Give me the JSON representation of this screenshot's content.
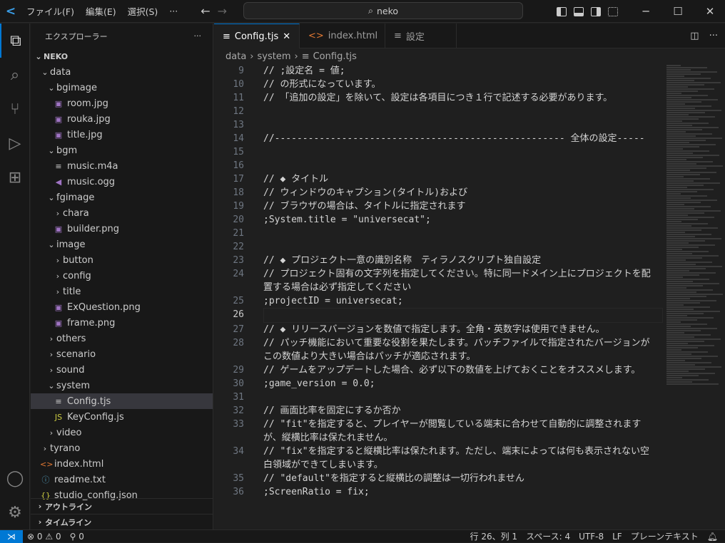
{
  "titlebar": {
    "menus": [
      "ファイル(F)",
      "編集(E)",
      "選択(S)",
      "···"
    ],
    "search": "neko"
  },
  "sidebar": {
    "title": "エクスプローラー",
    "more": "···",
    "root": "NEKO",
    "items": [
      {
        "label": "data",
        "depth": 1,
        "type": "folder-open"
      },
      {
        "label": "bgimage",
        "depth": 2,
        "type": "folder-open"
      },
      {
        "label": "room.jpg",
        "depth": 3,
        "type": "image"
      },
      {
        "label": "rouka.jpg",
        "depth": 3,
        "type": "image"
      },
      {
        "label": "title.jpg",
        "depth": 3,
        "type": "image"
      },
      {
        "label": "bgm",
        "depth": 2,
        "type": "folder-open"
      },
      {
        "label": "music.m4a",
        "depth": 3,
        "type": "text"
      },
      {
        "label": "music.ogg",
        "depth": 3,
        "type": "audio"
      },
      {
        "label": "fgimage",
        "depth": 2,
        "type": "folder-open"
      },
      {
        "label": "chara",
        "depth": 3,
        "type": "folder"
      },
      {
        "label": "builder.png",
        "depth": 3,
        "type": "image"
      },
      {
        "label": "image",
        "depth": 2,
        "type": "folder-open"
      },
      {
        "label": "button",
        "depth": 3,
        "type": "folder"
      },
      {
        "label": "config",
        "depth": 3,
        "type": "folder"
      },
      {
        "label": "title",
        "depth": 3,
        "type": "folder"
      },
      {
        "label": "ExQuestion.png",
        "depth": 3,
        "type": "image"
      },
      {
        "label": "frame.png",
        "depth": 3,
        "type": "image"
      },
      {
        "label": "others",
        "depth": 2,
        "type": "folder"
      },
      {
        "label": "scenario",
        "depth": 2,
        "type": "folder"
      },
      {
        "label": "sound",
        "depth": 2,
        "type": "folder"
      },
      {
        "label": "system",
        "depth": 2,
        "type": "folder-open"
      },
      {
        "label": "Config.tjs",
        "depth": 3,
        "type": "text",
        "selected": true
      },
      {
        "label": "KeyConfig.js",
        "depth": 3,
        "type": "js"
      },
      {
        "label": "video",
        "depth": 2,
        "type": "folder"
      },
      {
        "label": "tyrano",
        "depth": 1,
        "type": "folder"
      },
      {
        "label": "index.html",
        "depth": 1,
        "type": "html"
      },
      {
        "label": "readme.txt",
        "depth": 1,
        "type": "info"
      },
      {
        "label": "studio_config.json",
        "depth": 1,
        "type": "json"
      }
    ],
    "outline": "アウトライン",
    "timeline": "タイムライン"
  },
  "tabs": [
    {
      "label": "Config.tjs",
      "icon": "text",
      "active": true
    },
    {
      "label": "index.html",
      "icon": "html"
    },
    {
      "label": "設定",
      "icon": "text"
    }
  ],
  "breadcrumb": [
    "data",
    "system",
    "Config.tjs"
  ],
  "editor": {
    "current_line": 26,
    "lines": [
      {
        "n": "9",
        "t": "// ;設定名 = 値;"
      },
      {
        "n": "10",
        "t": "// の形式になっています。"
      },
      {
        "n": "11",
        "t": "// 「追加の設定」を除いて、設定は各項目につき１行で記述する必要があります。"
      },
      {
        "n": "12",
        "t": ""
      },
      {
        "n": "13",
        "t": ""
      },
      {
        "n": "14",
        "t": "//---------------------------------------------------- 全体の設定-----"
      },
      {
        "n": "15",
        "t": ""
      },
      {
        "n": "16",
        "t": ""
      },
      {
        "n": "17",
        "t": "// ◆ タイトル"
      },
      {
        "n": "18",
        "t": "// ウィンドウのキャプション(タイトル)および"
      },
      {
        "n": "19",
        "t": "// ブラウザの場合は、タイトルに指定されます"
      },
      {
        "n": "20",
        "t": ";System.title = \"universecat\";"
      },
      {
        "n": "21",
        "t": ""
      },
      {
        "n": "22",
        "t": ""
      },
      {
        "n": "23",
        "t": "// ◆ プロジェクト一意の識別名称　ティラノスクリプト独自設定"
      },
      {
        "n": "24",
        "t": "// プロジェクト固有の文字列を指定してください。特に同一ドメイン上にプロジェクトを配置する場合は必ず指定してください"
      },
      {
        "n": "25",
        "t": ";projectID = universecat;"
      },
      {
        "n": "26",
        "t": ""
      },
      {
        "n": "27",
        "t": "// ◆ リリースバージョンを数値で指定します。全角・英数字は使用できません。"
      },
      {
        "n": "28",
        "t": "// パッチ機能において重要な役割を果たします。パッチファイルで指定されたバージョンがこの数値より大きい場合はパッチが適応されます。"
      },
      {
        "n": "29",
        "t": "// ゲームをアップデートした場合、必ず以下の数値を上げておくことをオススメします。"
      },
      {
        "n": "30",
        "t": ";game_version = 0.0;"
      },
      {
        "n": "31",
        "t": ""
      },
      {
        "n": "32",
        "t": "// 画面比率を固定にするか否か"
      },
      {
        "n": "33",
        "t": "// \"fit\"を指定すると、プレイヤーが閲覧している端末に合わせて自動的に調整されますが、縦横比率は保たれません。"
      },
      {
        "n": "34",
        "t": "// \"fix\"を指定すると縦横比率は保たれます。ただし、端末によっては何も表示されない空白領域ができてしまいます。"
      },
      {
        "n": "35",
        "t": "// \"default\"を指定すると縦横比の調整は一切行われません"
      },
      {
        "n": "36",
        "t": ";ScreenRatio = fix;"
      }
    ]
  },
  "statusbar": {
    "errors": "0",
    "warnings": "0",
    "ports": "0",
    "position": "行 26、列 1",
    "spaces": "スペース: 4",
    "encoding": "UTF-8",
    "eol": "LF",
    "language": "プレーンテキスト"
  },
  "colors": {
    "accent": "#0078d4",
    "background": "#1f1f1f"
  }
}
